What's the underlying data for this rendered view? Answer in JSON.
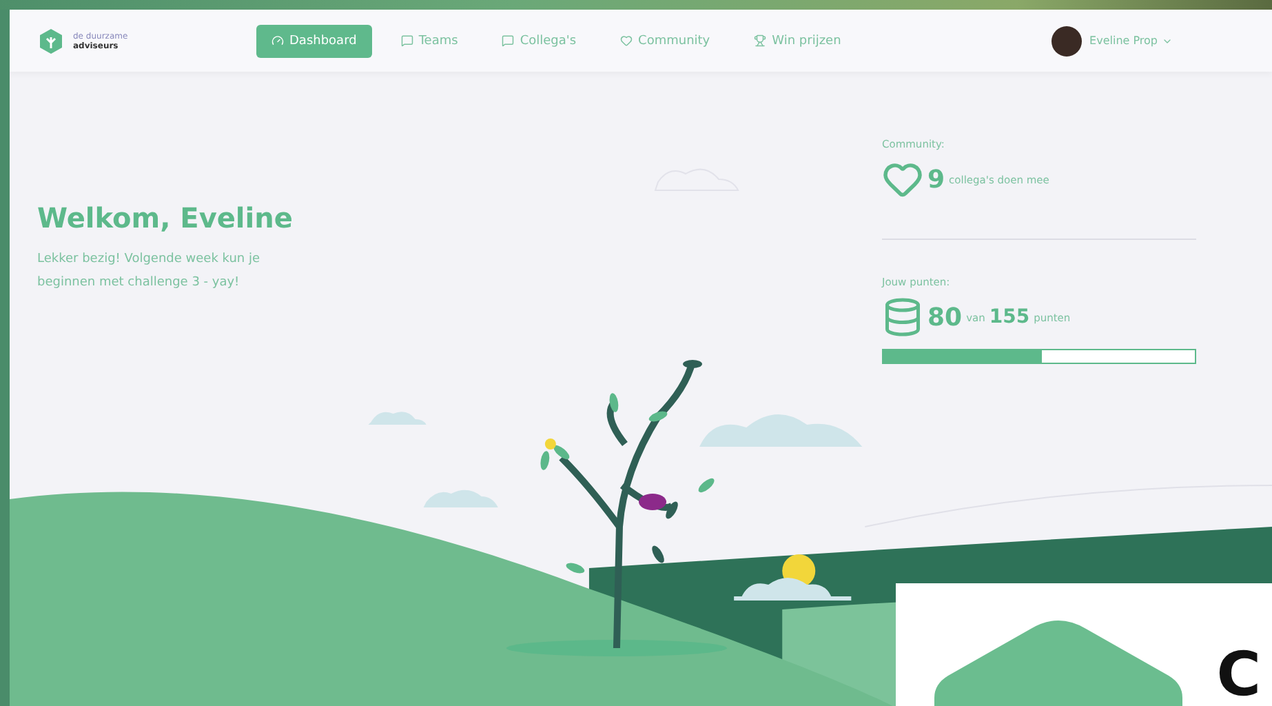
{
  "brand": {
    "line1": "de duurzame",
    "line2": "adviseurs"
  },
  "nav": [
    {
      "label": "Dashboard",
      "kind": "gauge",
      "selected": true
    },
    {
      "label": "Teams",
      "kind": "chat",
      "selected": false
    },
    {
      "label": "Collega's",
      "kind": "chat",
      "selected": false
    },
    {
      "label": "Community",
      "kind": "heart",
      "selected": false
    },
    {
      "label": "Win prijzen",
      "kind": "trophy",
      "selected": false
    }
  ],
  "user": {
    "name": "Eveline Prop"
  },
  "welcome": {
    "title": "Welkom, Eveline",
    "message": "Lekker bezig! Volgende week kun je beginnen met challenge 3 - yay!"
  },
  "community": {
    "label": "Community:",
    "count": "9",
    "text": "collega's doen mee"
  },
  "points": {
    "label": "Jouw punten:",
    "value": "80",
    "of": "van",
    "total": "155",
    "unit": "punten",
    "level": 0.51
  },
  "overlay": {
    "letter": "C"
  }
}
